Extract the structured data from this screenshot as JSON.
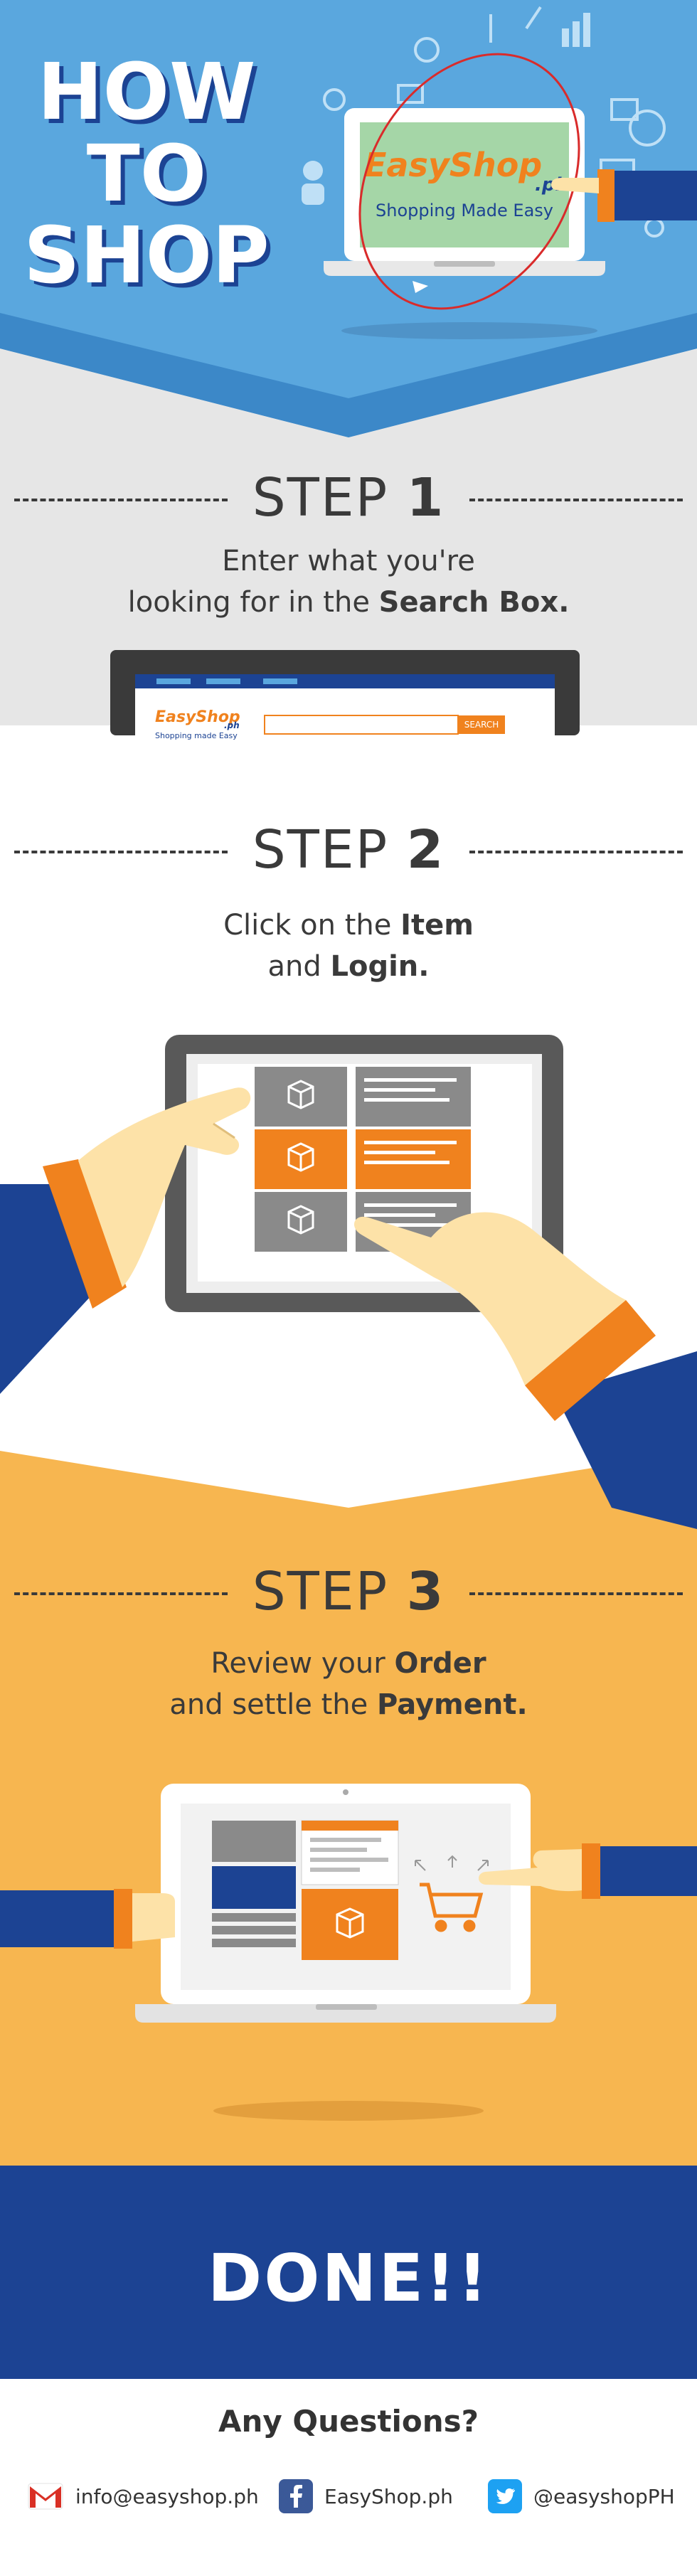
{
  "header": {
    "title_line1": "HOW",
    "title_line2": "TO",
    "title_line3": "SHOP",
    "logo_main": "EasyShop",
    "logo_suffix": ".ph",
    "tagline": "Shopping Made Easy"
  },
  "step1": {
    "word": "STEP",
    "number": "1",
    "line1": "Enter what you're",
    "line2_pre": "looking for in the ",
    "line2_bold": "Search Box.",
    "mock_logo": "EasyShop",
    "mock_logo_suffix": ".ph",
    "mock_tagline": "Shopping made Easy",
    "mock_search_button": "SEARCH"
  },
  "step2": {
    "word": "STEP",
    "number": "2",
    "line1_pre": "Click on the ",
    "line1_bold": "Item",
    "line2_pre": "and ",
    "line2_bold": "Login."
  },
  "step3": {
    "word": "STEP",
    "number": "3",
    "line1_pre": "Review your ",
    "line1_bold": "Order",
    "line2_pre": "and settle the ",
    "line2_bold": "Payment."
  },
  "done": {
    "label": "DONE!!"
  },
  "footer": {
    "question": "Any Questions?",
    "email": "info@easyshop.ph",
    "facebook": "EasyShop.ph",
    "twitter": "@easyshopPH"
  },
  "colors": {
    "sky_blue": "#5aa7de",
    "light_gray": "#e6e6e6",
    "navy": "#1c4393",
    "orange": "#f0821e",
    "yellow": "#f7b650",
    "skin": "#fde2a8",
    "dark_text": "#3a3a3a"
  },
  "icons": [
    "gmail-icon",
    "facebook-icon",
    "twitter-icon",
    "box-icon",
    "cart-icon"
  ]
}
